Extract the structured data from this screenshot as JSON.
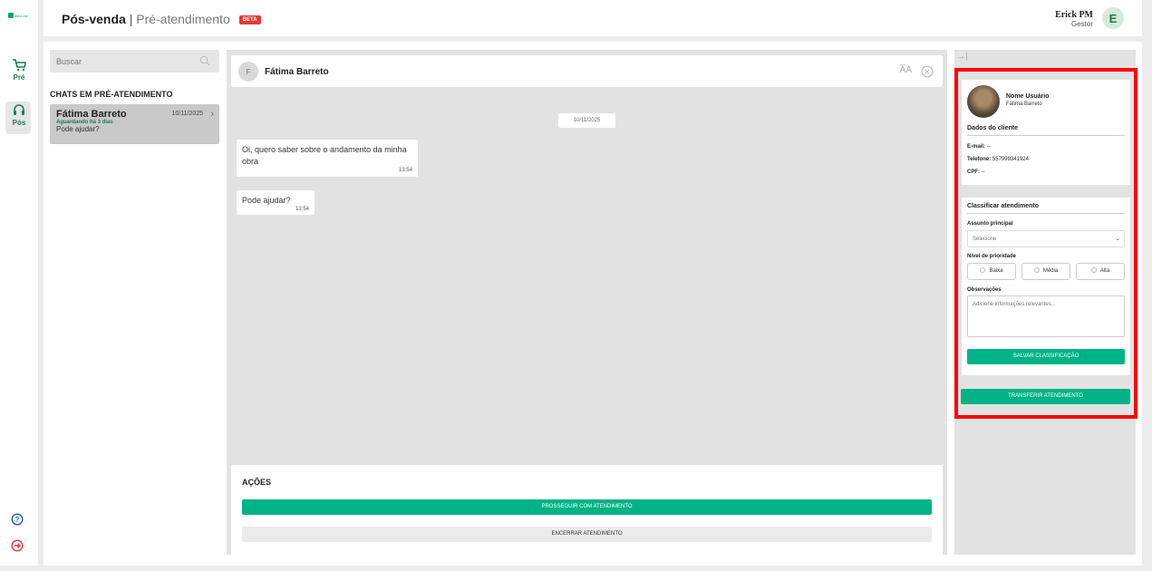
{
  "rail": {
    "logo_text": "elevLine",
    "nav_pre": "Pré",
    "nav_pos": "Pós"
  },
  "header": {
    "title": "Pós-venda",
    "separator": "|",
    "subtitle": "Pré-atendimento",
    "badge": "BETA",
    "user_name": "Erick PM",
    "user_role": "Gestor",
    "avatar_letter": "E"
  },
  "chat_list": {
    "search_placeholder": "Buscar",
    "section_title": "CHATS EM PRÉ-ATENDIMENTO",
    "items": [
      {
        "name": "Fátima Barreto",
        "date": "10/11/2025",
        "status": "Aguardando há 3 dias",
        "preview": "Pode ajudar?"
      }
    ]
  },
  "conversation": {
    "avatar_letter": "F",
    "contact_name": "Fátima Barreto",
    "date_chip": "10/11/2025",
    "messages": [
      {
        "text": "Oi, quero saber sobre o andamento da minha obra",
        "time": "13:54"
      },
      {
        "text": "Pode ajudar?",
        "time": "13:54"
      }
    ]
  },
  "actions": {
    "label": "AÇÕES",
    "continue": "PROSSEGUIR COM ATENDIMENTO",
    "close": "ENCERRAR ATENDIMENTO"
  },
  "side_panel": {
    "user_label": "Nome Usuário",
    "user_value": "Fátima Barreto",
    "client_section": "Dados do cliente",
    "email_label": "E-mail:",
    "email_value": "--",
    "phone_label": "Telefone:",
    "phone_value": "557999341924",
    "cpf_label": "CPF:",
    "cpf_value": "--",
    "classify_section": "Classificar atendimento",
    "subject_label": "Assunto principal",
    "subject_placeholder": "Selecione",
    "priority_label": "Nível de prioridade",
    "priority_options": [
      "Baixa",
      "Média",
      "Alta"
    ],
    "notes_label": "Observações",
    "notes_placeholder": "Adicione informações relevantes...",
    "save": "SALVAR CLASSIFICAÇÃO",
    "transfer": "TRANSFERIR ATENDIMENTO"
  },
  "colors": {
    "accent": "#00b386",
    "brand_green": "#1f7a4c",
    "badge_red": "#e53935",
    "highlight_box": "#ff0000"
  }
}
